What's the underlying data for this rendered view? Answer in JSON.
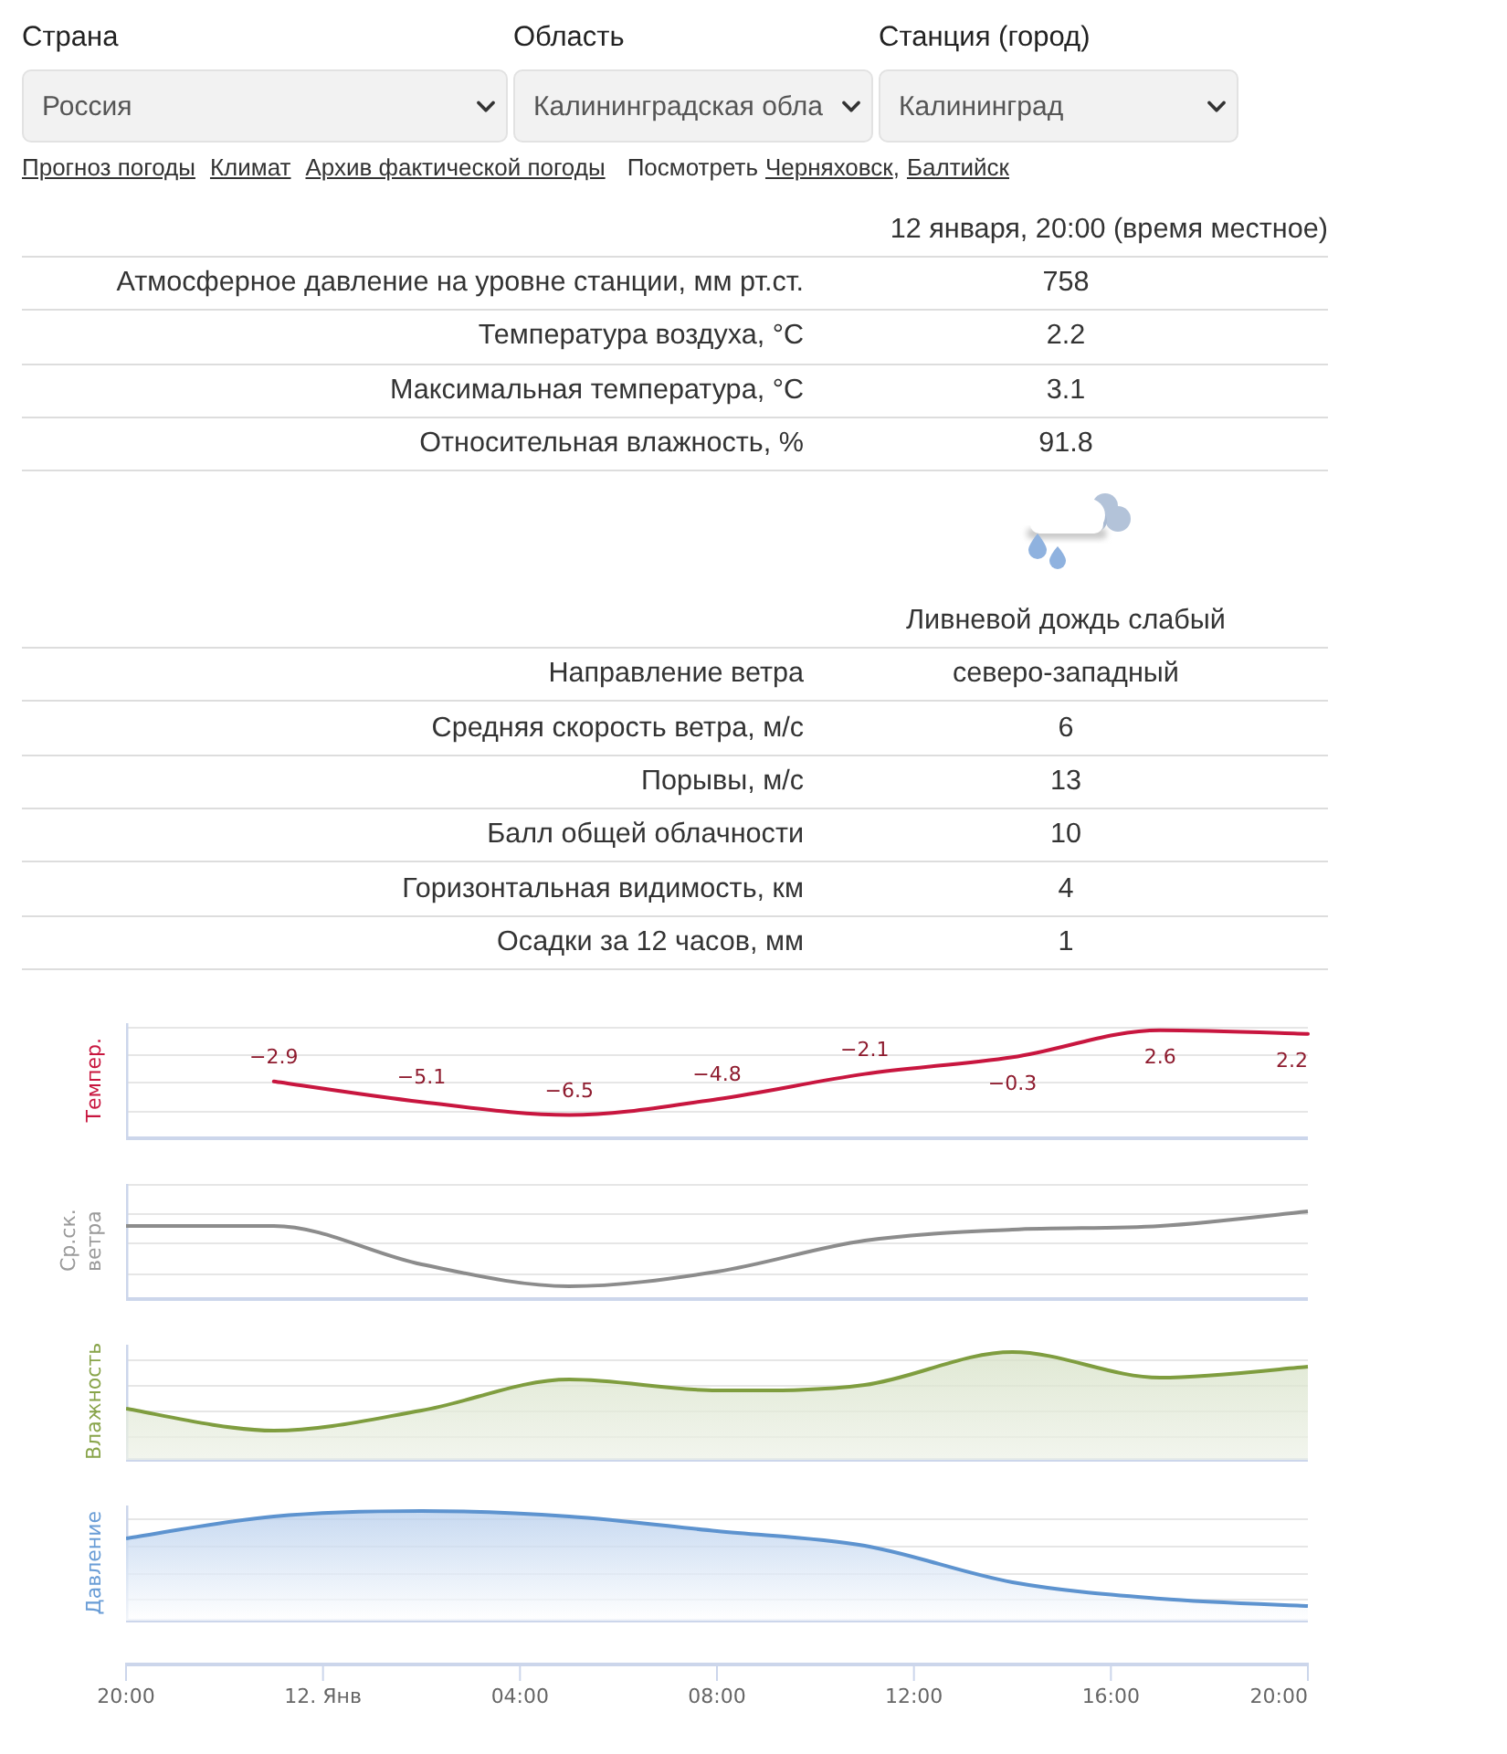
{
  "location_fields": [
    {
      "label": "Страна",
      "value": "Россия"
    },
    {
      "label": "Область",
      "value": "Калининградская обла"
    },
    {
      "label": "Станция (город)",
      "value": "Калининград"
    }
  ],
  "links": [
    {
      "kind": "link",
      "text": "Прогноз погоды"
    },
    {
      "kind": "link",
      "text": "Климат"
    },
    {
      "kind": "link",
      "text": "Архив фактической погоды"
    },
    {
      "kind": "label",
      "text": "Посмотреть"
    },
    {
      "kind": "link",
      "text": "Черняховск"
    },
    {
      "kind": "punct",
      "text": ","
    },
    {
      "kind": "link",
      "text": "Балтийск"
    }
  ],
  "observation": {
    "time": "12 января, 20:00 (время местное)",
    "rows": [
      {
        "kind": "value",
        "label": "Атмосферное давление на уровне станции, мм рт.ст.",
        "value": "758"
      },
      {
        "kind": "value",
        "label": "Температура воздуха, °C",
        "value": "2.2"
      },
      {
        "kind": "value",
        "label": "Максимальная температура, °C",
        "value": "3.1"
      },
      {
        "kind": "value",
        "label": "Относительная влажность, %",
        "value": "91.8"
      },
      {
        "kind": "weather",
        "value": "Ливневой дождь слабый"
      },
      {
        "kind": "value",
        "label": "Направление ветра",
        "value": "северо-западный"
      },
      {
        "kind": "value",
        "label": "Средняя скорость ветра, м/с",
        "value": "6"
      },
      {
        "kind": "value",
        "label": "Порывы, м/с",
        "value": "13"
      },
      {
        "kind": "value",
        "label": "Балл общей облачности",
        "value": "10"
      },
      {
        "kind": "value",
        "label": "Горизонтальная видимость, км",
        "value": "4"
      },
      {
        "kind": "value",
        "label": "Осадки за 12 часов, мм",
        "value": "1"
      }
    ]
  },
  "charts": [
    {
      "kind": "temperature",
      "chart_data": {
        "type": "line",
        "ylabel": "Темпер.",
        "categories": [
          null,
          null,
          null,
          null,
          null,
          null,
          null,
          null,
          null
        ],
        "series": [
          {
            "color": "#c8163f",
            "values": [
              null,
              -2.9,
              -5.1,
              -6.5,
              -4.8,
              -2.1,
              -0.3,
              2.6,
              2.2
            ]
          }
        ],
        "data_labels": true
      }
    },
    {
      "kind": "wind",
      "ylabel": "Ср.ск. ветра"
    },
    {
      "kind": "humidity",
      "ylabel": "Влажность"
    },
    {
      "kind": "pressure",
      "ylabel": "Давление"
    }
  ],
  "time_axis": {
    "ticks": [
      "20:00",
      "12. Янв",
      "04:00",
      "08:00",
      "12:00",
      "16:00",
      "20:00"
    ]
  }
}
